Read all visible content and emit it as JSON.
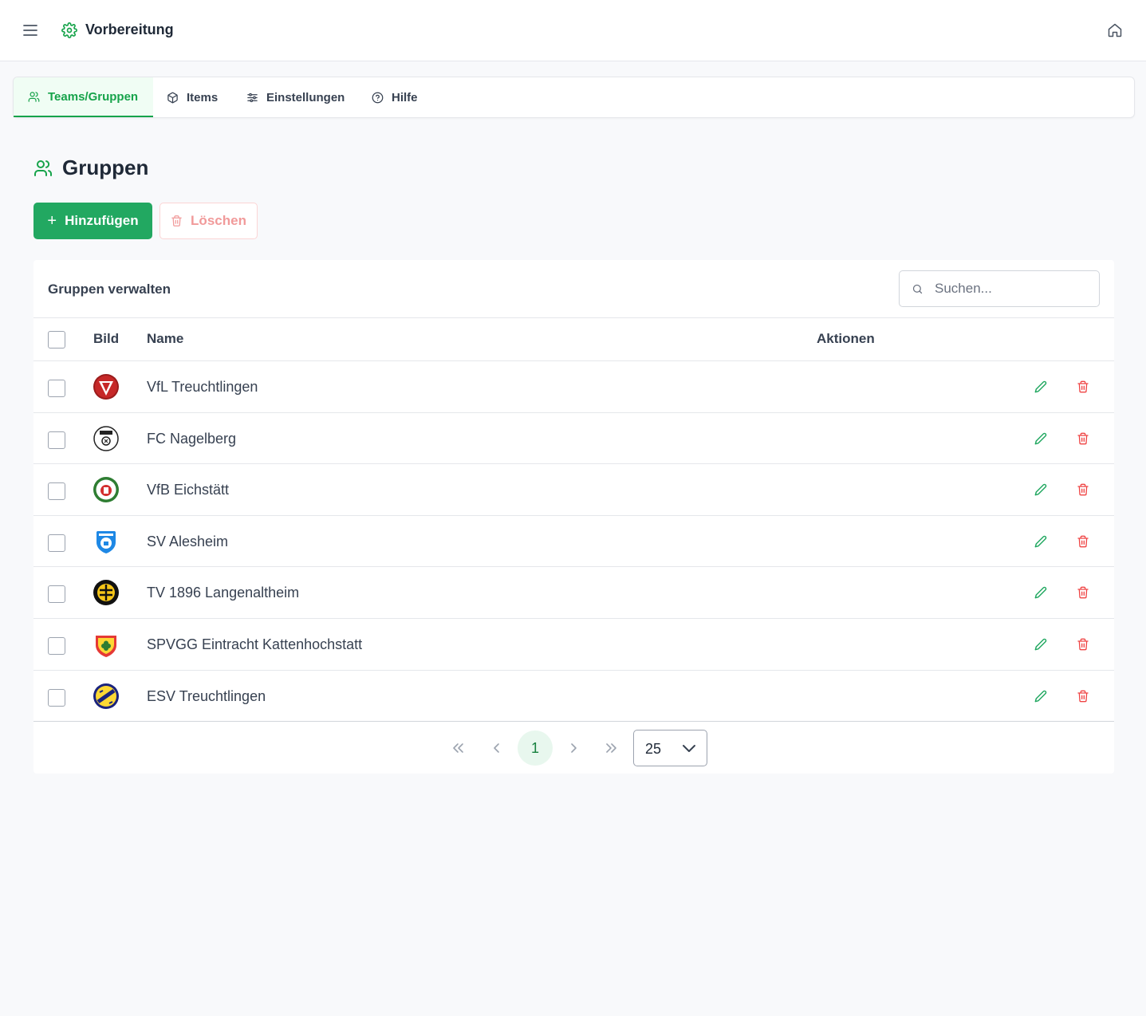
{
  "header": {
    "title": "Vorbereitung",
    "menu_icon": "hamburger-icon",
    "app_icon": "gear-icon",
    "home_icon": "home-icon"
  },
  "tabs": [
    {
      "label": "Teams/Gruppen",
      "icon": "users-icon",
      "active": true
    },
    {
      "label": "Items",
      "icon": "box-icon",
      "active": false
    },
    {
      "label": "Einstellungen",
      "icon": "sliders-icon",
      "active": false
    },
    {
      "label": "Hilfe",
      "icon": "help-circle-icon",
      "active": false
    }
  ],
  "page": {
    "title": "Gruppen",
    "add_label": "Hinzufügen",
    "delete_label": "Löschen"
  },
  "table": {
    "title": "Gruppen verwalten",
    "search_placeholder": "Suchen...",
    "columns": {
      "image": "Bild",
      "name": "Name",
      "actions": "Aktionen"
    },
    "rows": [
      {
        "name": "VfL Treuchtlingen"
      },
      {
        "name": "FC Nagelberg"
      },
      {
        "name": "VfB Eichstätt"
      },
      {
        "name": "SV Alesheim"
      },
      {
        "name": "TV 1896 Langenaltheim"
      },
      {
        "name": "SPVGG Eintracht Kattenhochstatt"
      },
      {
        "name": "ESV Treuchtlingen"
      }
    ]
  },
  "pagination": {
    "current_page": "1",
    "page_size": "25"
  },
  "colors": {
    "accent": "#22a861",
    "danger": "#ef4444",
    "danger_light": "#f19a9a"
  }
}
